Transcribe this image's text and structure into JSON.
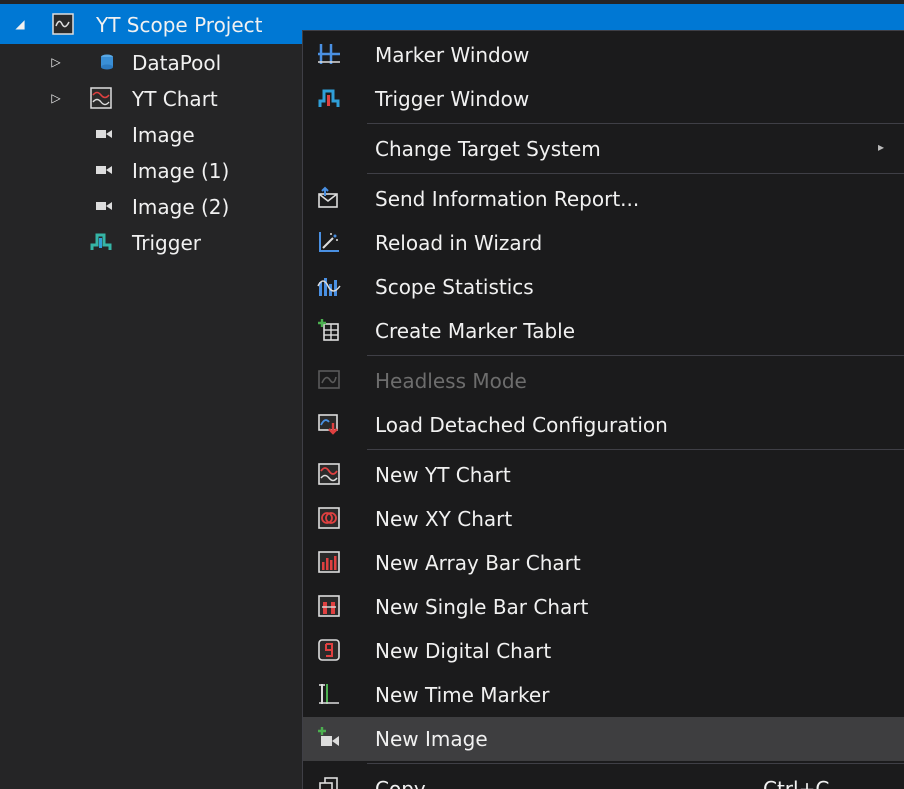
{
  "tree": {
    "root": {
      "label": "YT Scope Project",
      "expander": "◢"
    },
    "items": [
      {
        "label": "DataPool",
        "expander": "▷",
        "icon": "datapool-icon"
      },
      {
        "label": "YT Chart",
        "expander": "▷",
        "icon": "yt-chart-icon"
      },
      {
        "label": "Image",
        "icon": "image-camera-icon"
      },
      {
        "label": "Image (1)",
        "icon": "image-camera-icon"
      },
      {
        "label": "Image (2)",
        "icon": "image-camera-icon"
      },
      {
        "label": "Trigger",
        "icon": "trigger-icon"
      }
    ]
  },
  "menu": {
    "items": [
      {
        "label": "Marker Window",
        "icon": "marker-window-icon"
      },
      {
        "label": "Trigger Window",
        "icon": "trigger-window-icon"
      },
      {
        "label": "Change Target System",
        "submenu_arrow": "▸"
      },
      {
        "label": "Send Information Report...",
        "icon": "send-report-icon"
      },
      {
        "label": "Reload in Wizard",
        "icon": "reload-wizard-icon"
      },
      {
        "label": "Scope Statistics",
        "icon": "scope-statistics-icon"
      },
      {
        "label": "Create Marker Table",
        "icon": "create-marker-table-icon"
      },
      {
        "label": "Headless Mode",
        "icon": "headless-mode-icon",
        "disabled": true
      },
      {
        "label": "Load Detached Configuration",
        "icon": "load-detached-config-icon"
      },
      {
        "label": "New YT Chart",
        "icon": "new-yt-chart-icon"
      },
      {
        "label": "New XY Chart",
        "icon": "new-xy-chart-icon"
      },
      {
        "label": "New Array Bar Chart",
        "icon": "new-array-bar-chart-icon"
      },
      {
        "label": "New Single Bar Chart",
        "icon": "new-single-bar-chart-icon"
      },
      {
        "label": "New Digital Chart",
        "icon": "new-digital-chart-icon"
      },
      {
        "label": "New Time Marker",
        "icon": "new-time-marker-icon"
      },
      {
        "label": "New Image",
        "icon": "new-image-icon",
        "hovered": true
      },
      {
        "label": "Copy",
        "icon": "copy-icon",
        "shortcut": "Ctrl+C"
      }
    ]
  },
  "colors": {
    "background": "#252526",
    "selection": "#0078d4",
    "menu_bg": "#1b1b1c",
    "hover": "#3e3e40",
    "disabled_text": "#6d6d6d"
  }
}
